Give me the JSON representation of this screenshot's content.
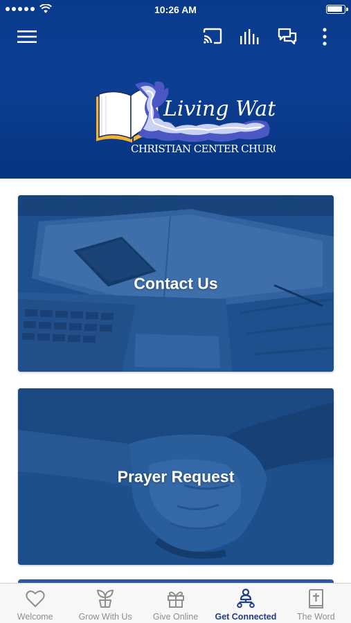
{
  "status_bar": {
    "time": "10:26 AM",
    "signal_bars": 5,
    "battery_level": 0.9
  },
  "header": {
    "logo": {
      "line1": "Living Water",
      "line2": "CHRISTIAN CENTER CHURCH"
    }
  },
  "toolbar": {
    "menu_icon": "hamburger-menu-icon",
    "cast_icon": "cast-icon",
    "audio_icon": "audio-bars-icon",
    "chat_icon": "chat-bubbles-icon",
    "more_icon": "more-vertical-icon"
  },
  "cards": [
    {
      "label": "Contact Us",
      "image": "laptop-notebook-desk-photo"
    },
    {
      "label": "Prayer Request",
      "image": "clasped-hands-photo"
    }
  ],
  "tabbar": {
    "active_index": 3,
    "items": [
      {
        "label": "Welcome",
        "icon": "heart-icon"
      },
      {
        "label": "Grow With Us",
        "icon": "sprout-icon"
      },
      {
        "label": "Give Online",
        "icon": "gift-icon"
      },
      {
        "label": "Get Connected",
        "icon": "people-network-icon"
      },
      {
        "label": "The Word",
        "icon": "bible-icon"
      }
    ]
  },
  "colors": {
    "header_bg": "#0a3a8c",
    "card_tint": "#1d4f8e",
    "tab_active": "#1e3f86",
    "tab_inactive": "#8e8e93"
  }
}
